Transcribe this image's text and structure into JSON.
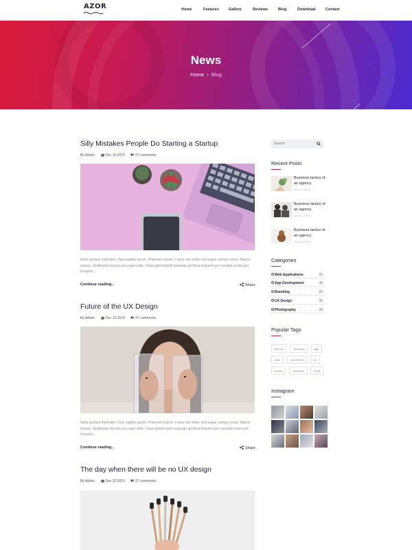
{
  "nav": {
    "logo_text": "AZOR",
    "items": [
      "Home",
      "Features",
      "Gallery",
      "Reviews",
      "Blog",
      "Download",
      "Contact"
    ]
  },
  "hero": {
    "title": "News",
    "breadcrumb_home": "Home",
    "breadcrumb_sep": "›",
    "breadcrumb_current": "Blog"
  },
  "posts": [
    {
      "title": "Silly Mistakes People Do Starting a Startup",
      "author": "By Admin",
      "date": "Dec 10,2019",
      "comments": "07 comments",
      "excerpt": "Nulla quntum imperdiet. Duis sagittis ipsum. Praesent mauris. Fusce nec tellus sed augue semper porta. Mauris massa. Vestibulum lacinia arcu eget nulla. Class aptent taciti sociosqu ad litora torquent per conubia nostra per inceptos...",
      "read_more": "Continue reading..",
      "share": "Share"
    },
    {
      "title": "Future of the UX Design",
      "author": "By Admin",
      "date": "Dec 10,2019",
      "comments": "07 comments",
      "excerpt": "Nulla quntum imperdiet. Duis sagittis ipsum. Praesent mauris. Fusce nec tellus sed augue semper porta. Mauris massa. Vestibulum lacinia arcu eget nulla. Class aptent taciti sociosqu ad litora torquent per conubia nostra per inceptos...",
      "read_more": "Continue reading..",
      "share": "Share"
    },
    {
      "title": "The day when there will be no UX design",
      "author": "By Admin",
      "date": "Dec 10,2019",
      "comments": "07 comments"
    }
  ],
  "sidebar": {
    "search_placeholder": "Search",
    "recent_heading": "Recent Posts",
    "recent": [
      {
        "title": "Business tactics of an agency",
        "date": "July 04, 2019"
      },
      {
        "title": "Business tactics of an agency",
        "date": "July 04, 2019"
      },
      {
        "title": "Business tactics of an agency",
        "date": "July 04, 2019"
      }
    ],
    "categories_heading": "Categories",
    "categories": [
      {
        "name": "Web Applications",
        "count": "15"
      },
      {
        "name": "App Development",
        "count": "15"
      },
      {
        "name": "Branding",
        "count": "15"
      },
      {
        "name": "UX Design",
        "count": "15"
      },
      {
        "name": "Photography",
        "count": "15"
      }
    ],
    "tags_heading": "Popular Tags",
    "tags": [
      "Agency",
      "Branding",
      "App",
      "Web",
      "WordPress",
      "UX",
      "Envato",
      "Business",
      "HTML"
    ],
    "instagram_heading": "Instagram"
  },
  "colors": {
    "accent": "#c9294f",
    "hero_start": "#d81b3a",
    "hero_end": "#4a2bd0",
    "text_dark": "#23233a"
  }
}
